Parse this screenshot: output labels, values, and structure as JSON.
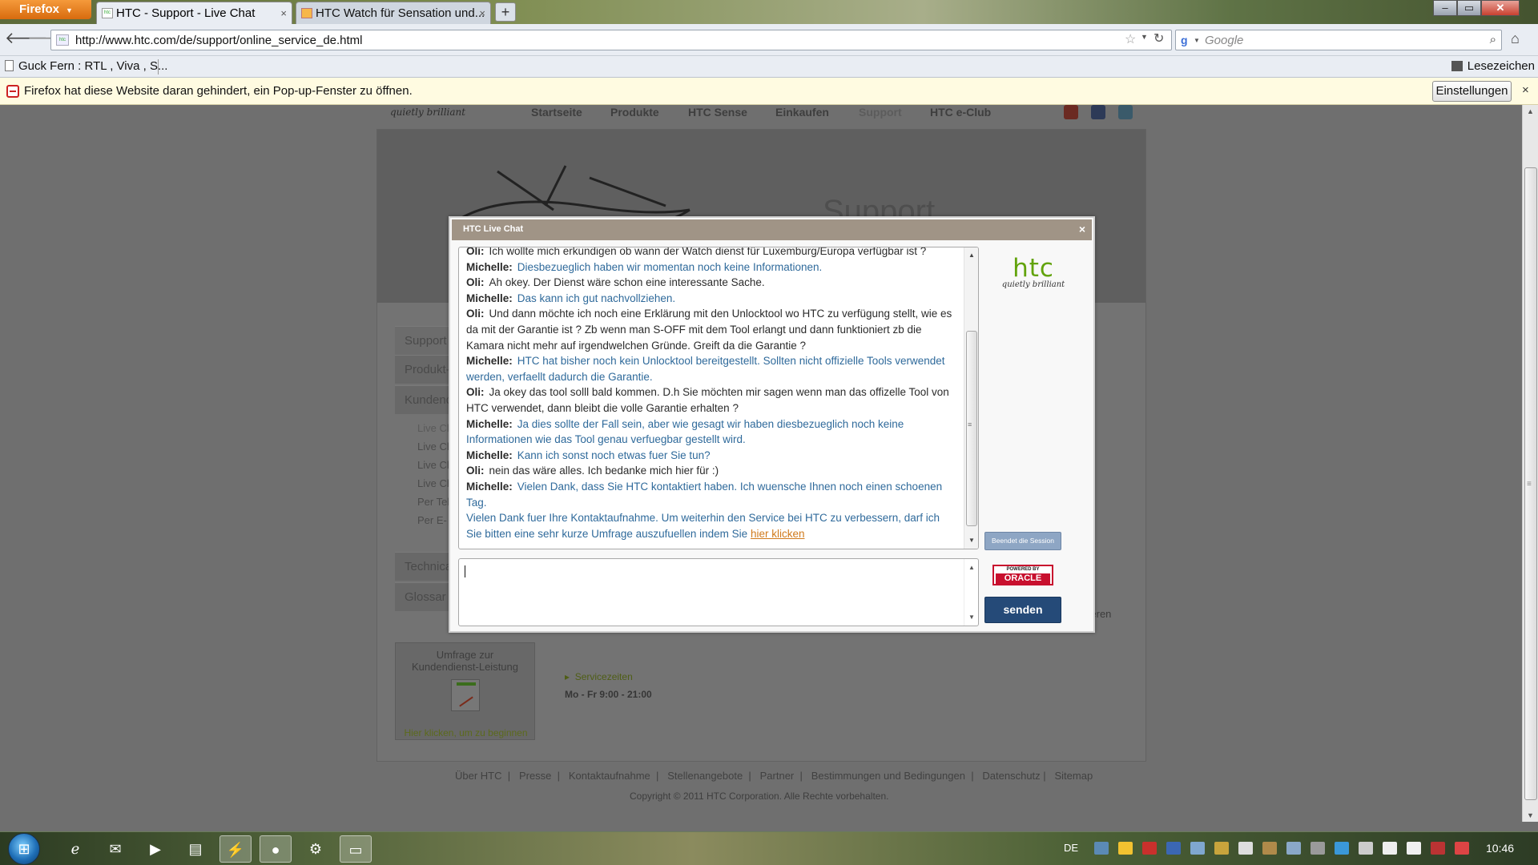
{
  "browser": {
    "menu_label": "Firefox",
    "tabs": [
      {
        "label": "HTC - Support - Live Chat",
        "favicon": "htc"
      },
      {
        "label": "HTC Watch für Sensation und...",
        "favicon": "page"
      }
    ],
    "new_tab_label": "+",
    "url": "http://www.htc.com/de/support/online_service_de.html",
    "search_placeholder": "Google",
    "bookmarks": [
      {
        "label": "Guck Fern : RTL , Viva , S..."
      }
    ],
    "bookmarks_menu_label": "Lesezeichen",
    "popup_notice": {
      "text": "Firefox hat diese Website daran gehindert, ein Pop-up-Fenster zu öffnen.",
      "settings_label": "Einstellungen",
      "close_label": "×"
    }
  },
  "site": {
    "tagline": "quietly brilliant",
    "nav": [
      "Startseite",
      "Produkte",
      "HTC Sense",
      "Einkaufen",
      "Support",
      "HTC e-Club"
    ],
    "banner_title": "Support",
    "sidebar": [
      "Support",
      "Produkt-",
      "Kundend",
      "Technica",
      "Glossar"
    ],
    "sidebar_sub": [
      "Live Ch",
      "Live Ch",
      "Live Ch",
      "Live Ch",
      "Per Tel",
      "Per E-"
    ],
    "survey_title": "Umfrage zur Kundendienst-Leistung",
    "survey_cta": "Hier klicken, um zu beginnen",
    "service_link": "Servicezeiten",
    "service_hours": "Mo - Fr 9:00 - 21:00",
    "clipped_text": "sieren",
    "footer_links": [
      "Über HTC",
      "Presse",
      "Kontaktaufnahme",
      "Stellenangebote",
      "Partner",
      "Bestimmungen und Bedingungen",
      "Datenschutz",
      "Sitemap"
    ],
    "copyright": "Copyright © 2011 HTC Corporation. Alle Rechte vorbehalten."
  },
  "chat": {
    "title": "HTC Live Chat",
    "close_label": "×",
    "messages": [
      {
        "speaker": "Oli:",
        "role": "customer",
        "text": "Ich wollte mich erkundigen ob wann der Watch dienst für Luxemburg/Europa verfügbar ist ?"
      },
      {
        "speaker": "Michelle:",
        "role": "agent",
        "text": "Diesbezueglich haben wir momentan noch keine Informationen."
      },
      {
        "speaker": "Oli:",
        "role": "customer",
        "text": "Ah okey. Der Dienst wäre schon eine interessante Sache."
      },
      {
        "speaker": "Michelle:",
        "role": "agent",
        "text": "Das kann ich gut nachvollziehen."
      },
      {
        "speaker": "Oli:",
        "role": "customer",
        "text": "Und dann möchte ich noch eine Erklärung mit den Unlocktool wo HTC zu verfügung stellt, wie es da mit der Garantie ist ? Zb wenn man S-OFF mit dem Tool erlangt und dann funktioniert zb die Kamara nicht mehr auf irgendwelchen Gründe. Greift da die Garantie ?"
      },
      {
        "speaker": "Michelle:",
        "role": "agent",
        "text": "HTC hat bisher noch kein Unlocktool bereitgestellt. Sollten nicht offizielle Tools verwendet werden, verfaellt dadurch die Garantie."
      },
      {
        "speaker": "Oli:",
        "role": "customer",
        "text": "Ja okey das tool solll bald kommen. D.h Sie möchten mir sagen wenn man das offizelle Tool von HTC verwendet, dann bleibt die volle Garantie erhalten ?"
      },
      {
        "speaker": "Michelle:",
        "role": "agent",
        "text": "Ja dies sollte der Fall sein, aber wie gesagt wir haben diesbezueglich noch keine Informationen wie das Tool genau verfuegbar gestellt wird."
      },
      {
        "speaker": "Michelle:",
        "role": "agent",
        "text": "Kann ich sonst noch etwas fuer Sie tun?"
      },
      {
        "speaker": "Oli:",
        "role": "customer",
        "text": "nein das wäre alles. Ich bedanke mich hier für :)"
      },
      {
        "speaker": "Michelle:",
        "role": "agent",
        "text": "Vielen Dank, dass Sie HTC kontaktiert haben. Ich wuensche Ihnen noch einen schoenen Tag."
      }
    ],
    "system_message": "Vielen Dank fuer Ihre Kontaktaufnahme. Um weiterhin den Service bei HTC zu verbessern, darf ich Sie bitten eine sehr kurze Umfrage auszufuellen indem Sie",
    "system_link": "hier klicken",
    "input_value": "",
    "brand": "htc",
    "brand_tagline": "quietly brilliant",
    "end_session_label": "Beendet die Session",
    "oracle_top": "POWERED BY",
    "oracle_name": "ORACLE",
    "send_label": "senden",
    "colors": {
      "header": "#a09486",
      "agent_text": "#2f6a9b",
      "send": "#254a78",
      "brand": "#62a30c"
    }
  },
  "taskbar": {
    "language": "DE",
    "clock": "10:46"
  }
}
